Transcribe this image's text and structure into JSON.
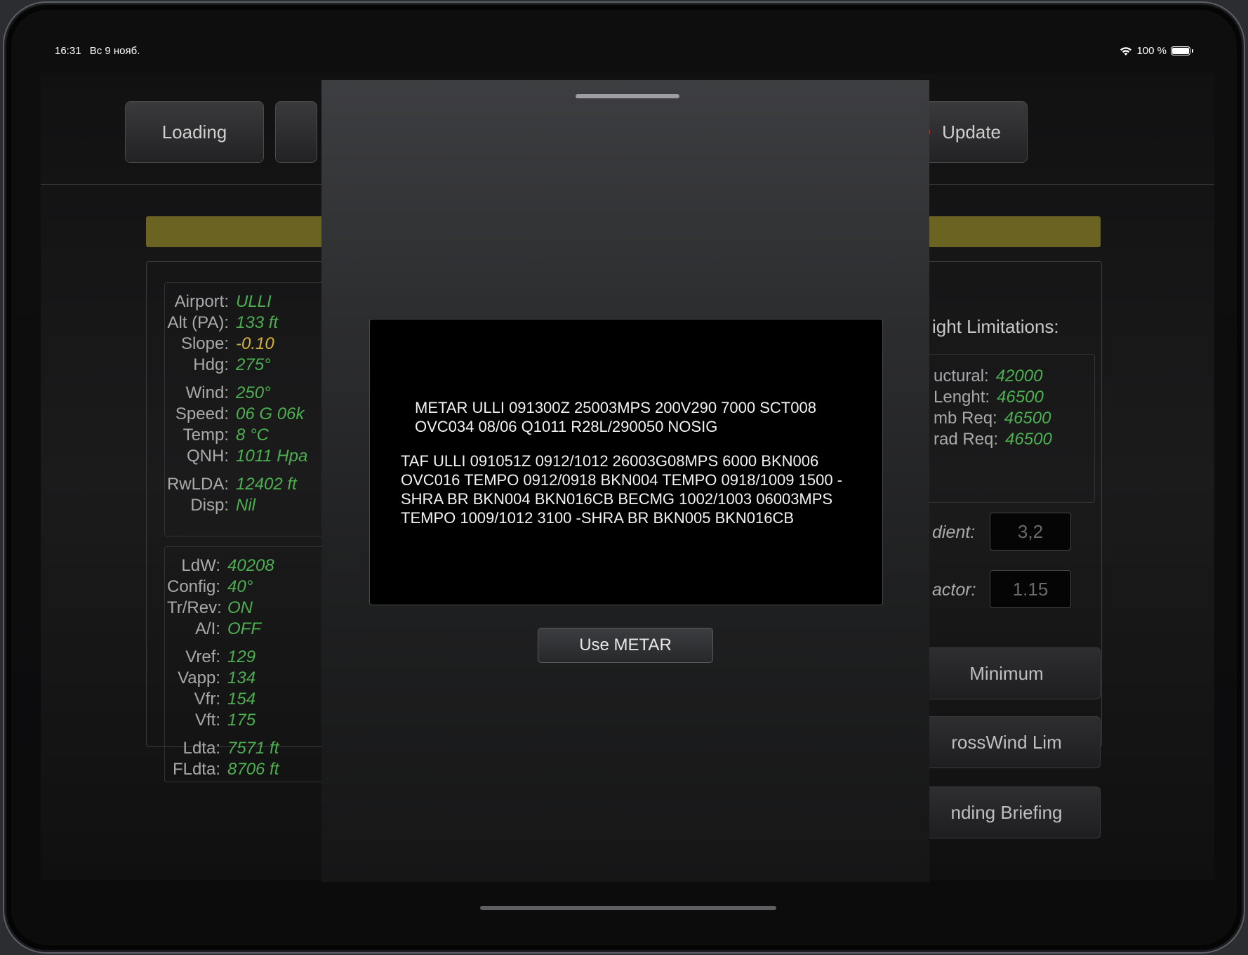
{
  "status_bar": {
    "time": "16:31",
    "date": "Вс 9 нояб.",
    "battery": "100 %"
  },
  "toolbar": {
    "loading_label": "Loading",
    "update_label": "Update"
  },
  "left_panel": {
    "group1": [
      {
        "label": "Airport:",
        "value": "ULLI"
      },
      {
        "label": "Alt (PA):",
        "value": "133 ft"
      },
      {
        "label": "Slope:",
        "value": "-0.10"
      },
      {
        "label": "Hdg:",
        "value": "275°"
      }
    ],
    "group2": [
      {
        "label": "Wind:",
        "value": "250°"
      },
      {
        "label": "Speed:",
        "value": "06 G 06k"
      },
      {
        "label": "Temp:",
        "value": "8 °C"
      },
      {
        "label": "QNH:",
        "value": "1011 Hpa"
      }
    ],
    "group3": [
      {
        "label": "RwLDA:",
        "value": "12402 ft"
      },
      {
        "label": "Disp:",
        "value": "Nil"
      }
    ],
    "group4": [
      {
        "label": "LdW:",
        "value": "40208"
      },
      {
        "label": "Config:",
        "value": "40°"
      },
      {
        "label": "Tr/Rev:",
        "value": "ON"
      },
      {
        "label": "A/I:",
        "value": "OFF"
      }
    ],
    "group5": [
      {
        "label": "Vref:",
        "value": "129"
      },
      {
        "label": "Vapp:",
        "value": "134"
      },
      {
        "label": "Vfr:",
        "value": "154"
      },
      {
        "label": "Vft:",
        "value": "175"
      }
    ],
    "group6": [
      {
        "label": "Ldta:",
        "value": "7571 ft"
      },
      {
        "label": "FLdta:",
        "value": "8706 ft"
      }
    ]
  },
  "right_panel": {
    "title": "ight Limitations:",
    "limits": [
      {
        "label": "uctural:",
        "value": "42000"
      },
      {
        "label": "Lenght:",
        "value": "46500"
      },
      {
        "label": "mb Req:",
        "value": "46500"
      },
      {
        "label": "rad Req:",
        "value": "46500"
      }
    ],
    "gradient_label": "dient:",
    "gradient_value": "3,2",
    "factor_label": "actor:",
    "factor_value": "1.15",
    "buttons": {
      "minimum": "Minimum",
      "crosswind": "rossWind Lim",
      "briefing": "nding Briefing"
    }
  },
  "modal": {
    "metar": "METAR ULLI 091300Z 25003MPS 200V290 7000 SCT008 OVC034 08/06 Q1011 R28L/290050 NOSIG",
    "taf": "TAF ULLI 091051Z 0912/1012 26003G08MPS 6000 BKN006 OVC016 TEMPO 0912/0918 BKN004 TEMPO 0918/1009 1500 -SHRA BR BKN004 BKN016CB BECMG 1002/1003 06003MPS TEMPO 1009/1012 3100 -SHRA BR BKN005 BKN016CB",
    "use_button": "Use METAR"
  },
  "colors": {
    "value_green": "#4caf50",
    "value_yellow": "#d4b23a",
    "alert_red": "#c0392b",
    "banner_olive": "#6b6322"
  }
}
